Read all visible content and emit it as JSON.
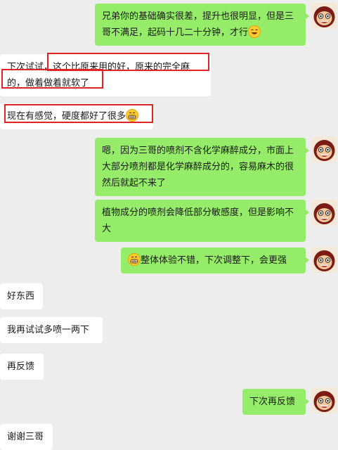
{
  "messages": [
    {
      "side": "right",
      "text": "兄弟你的基础确实很差，提升也很明显，但是三哥不满足，起码十几二十分钟，才行",
      "emoji_end": "laughing-emoji"
    },
    {
      "side": "left",
      "text": "下次试试，这个比原来用的好，原来的完全麻的，做着做着就软了"
    },
    {
      "side": "left",
      "text": "现在有感觉，硬度都好了很多",
      "emoji_end": "grinning-emoji"
    },
    {
      "side": "right",
      "text": "嗯，因为三哥的喷剂不含化学麻醉成分，市面上大部分喷剂都是化学麻醉成分的，容易麻木的很然后就起不来了"
    },
    {
      "side": "right",
      "text": "植物成分的喷剂会降低部分敏感度，但是影响不大"
    },
    {
      "side": "right",
      "text": "整体体验不错，下次调整下，会更强",
      "emoji_start": "grinning-emoji"
    },
    {
      "side": "left",
      "text": "好东西"
    },
    {
      "side": "left",
      "text": "我再试试多喷一两下"
    },
    {
      "side": "left",
      "text": "再反馈"
    },
    {
      "side": "right",
      "text": "下次再反馈"
    },
    {
      "side": "left",
      "text": "谢谢三哥"
    }
  ],
  "colors": {
    "background": "#ededed",
    "sent_bubble": "#95ec69",
    "received_bubble": "#ffffff",
    "highlight_box": "#e02424"
  }
}
